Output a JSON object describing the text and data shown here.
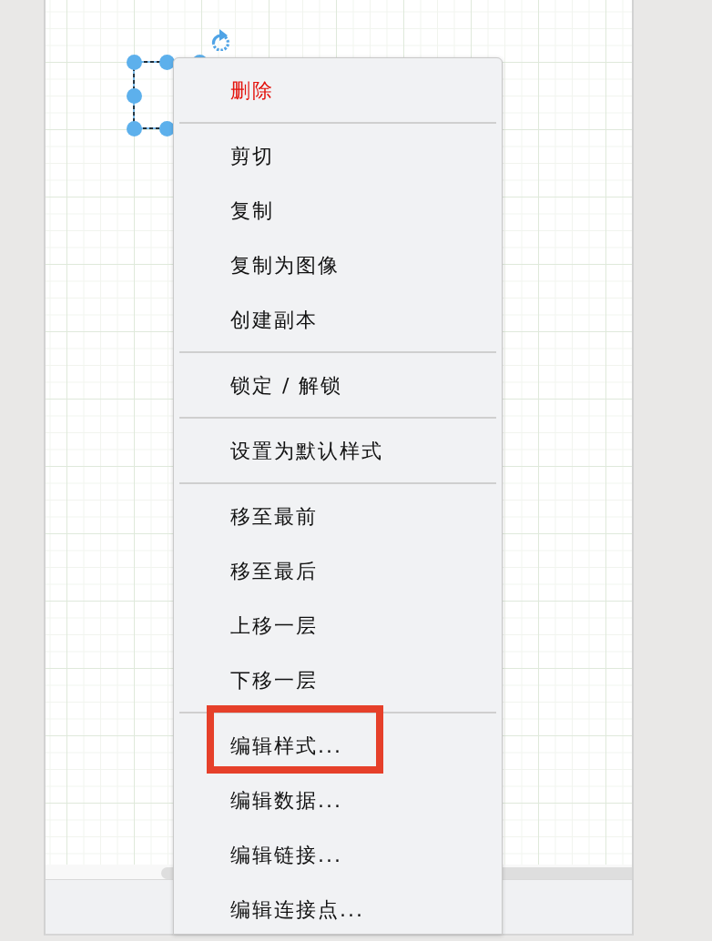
{
  "canvas": {
    "shape": {
      "selected": true
    }
  },
  "context_menu": {
    "groups": [
      {
        "items": [
          {
            "label": "删除",
            "danger": true,
            "annotated": false
          }
        ]
      },
      {
        "items": [
          {
            "label": "剪切",
            "danger": false,
            "annotated": false
          },
          {
            "label": "复制",
            "danger": false,
            "annotated": false
          },
          {
            "label": "复制为图像",
            "danger": false,
            "annotated": false
          },
          {
            "label": "创建副本",
            "danger": false,
            "annotated": false
          }
        ]
      },
      {
        "items": [
          {
            "label": "锁定 / 解锁",
            "danger": false,
            "annotated": false
          }
        ]
      },
      {
        "items": [
          {
            "label": "设置为默认样式",
            "danger": false,
            "annotated": false
          }
        ]
      },
      {
        "items": [
          {
            "label": "移至最前",
            "danger": false,
            "annotated": false
          },
          {
            "label": "移至最后",
            "danger": false,
            "annotated": false
          },
          {
            "label": "上移一层",
            "danger": false,
            "annotated": false
          },
          {
            "label": "下移一层",
            "danger": false,
            "annotated": false
          }
        ]
      },
      {
        "items": [
          {
            "label": "编辑样式...",
            "danger": false,
            "annotated": true
          },
          {
            "label": "编辑数据...",
            "danger": false,
            "annotated": false
          },
          {
            "label": "编辑链接...",
            "danger": false,
            "annotated": false
          },
          {
            "label": "编辑连接点...",
            "danger": false,
            "annotated": false
          }
        ]
      }
    ]
  }
}
